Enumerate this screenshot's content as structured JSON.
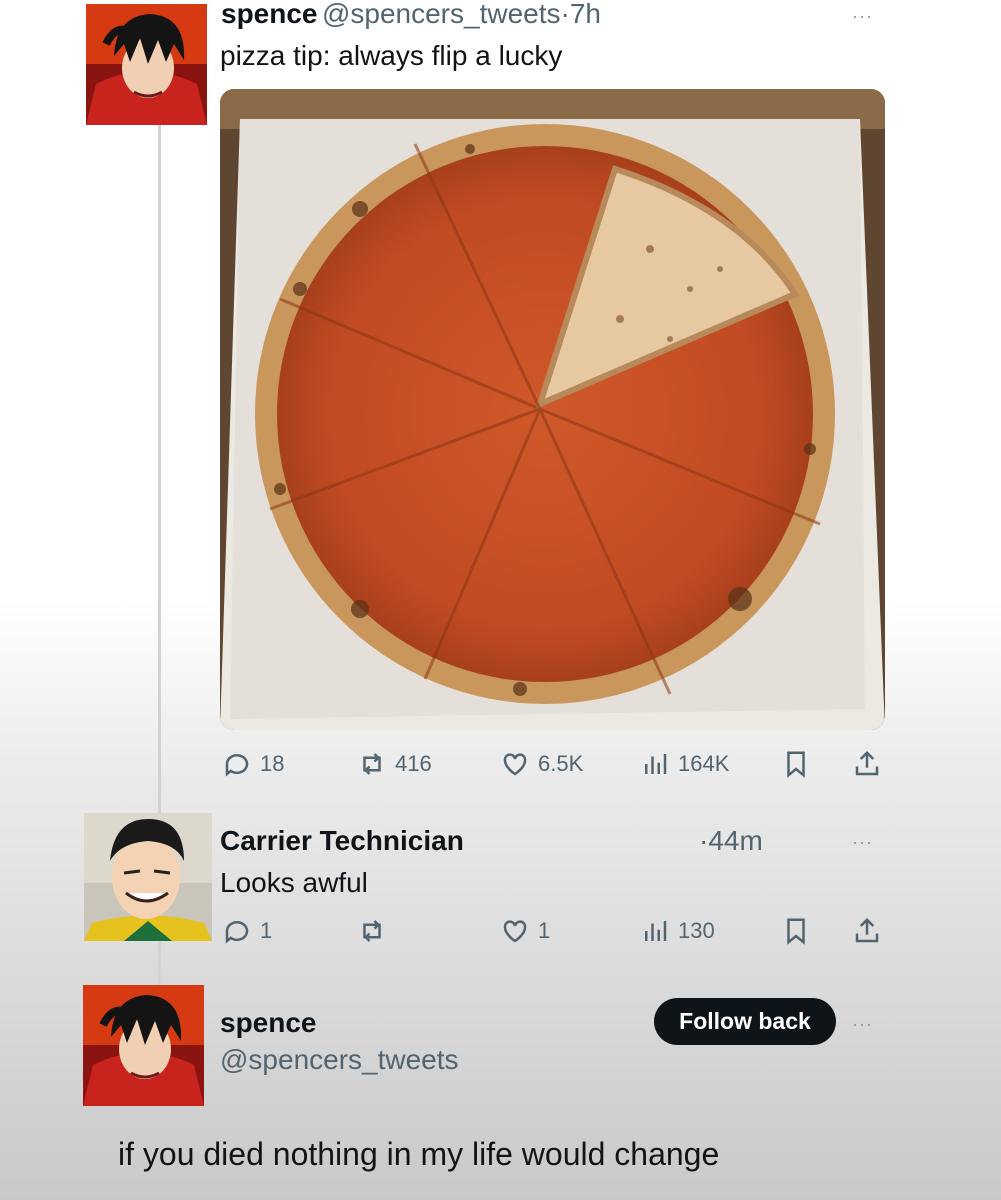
{
  "tweet": {
    "name": "spence",
    "handle": "@spencers_tweets",
    "dot": "·",
    "time": "7h",
    "text": "pizza tip: always flip a lucky",
    "more": "···",
    "image_alt_icon": "pizza-photo",
    "stats": {
      "replies": "18",
      "retweets": "416",
      "likes": "6.5K",
      "views": "164K"
    }
  },
  "reply": {
    "name": "Carrier Technician",
    "time": "·44m",
    "text": "Looks awful",
    "more": "···",
    "stats": {
      "replies": "1",
      "retweets": "",
      "likes": "1",
      "views": "130"
    }
  },
  "profile": {
    "name": "spence",
    "handle": "@spencers_tweets",
    "follow_label": "Follow back",
    "more": "···"
  },
  "caption": "if you died nothing in my life would change",
  "colors": {
    "avatar_red": "#c8231d",
    "avatar_hair": "#141414",
    "follow_button": "#0f1419",
    "muted": "#536471"
  }
}
